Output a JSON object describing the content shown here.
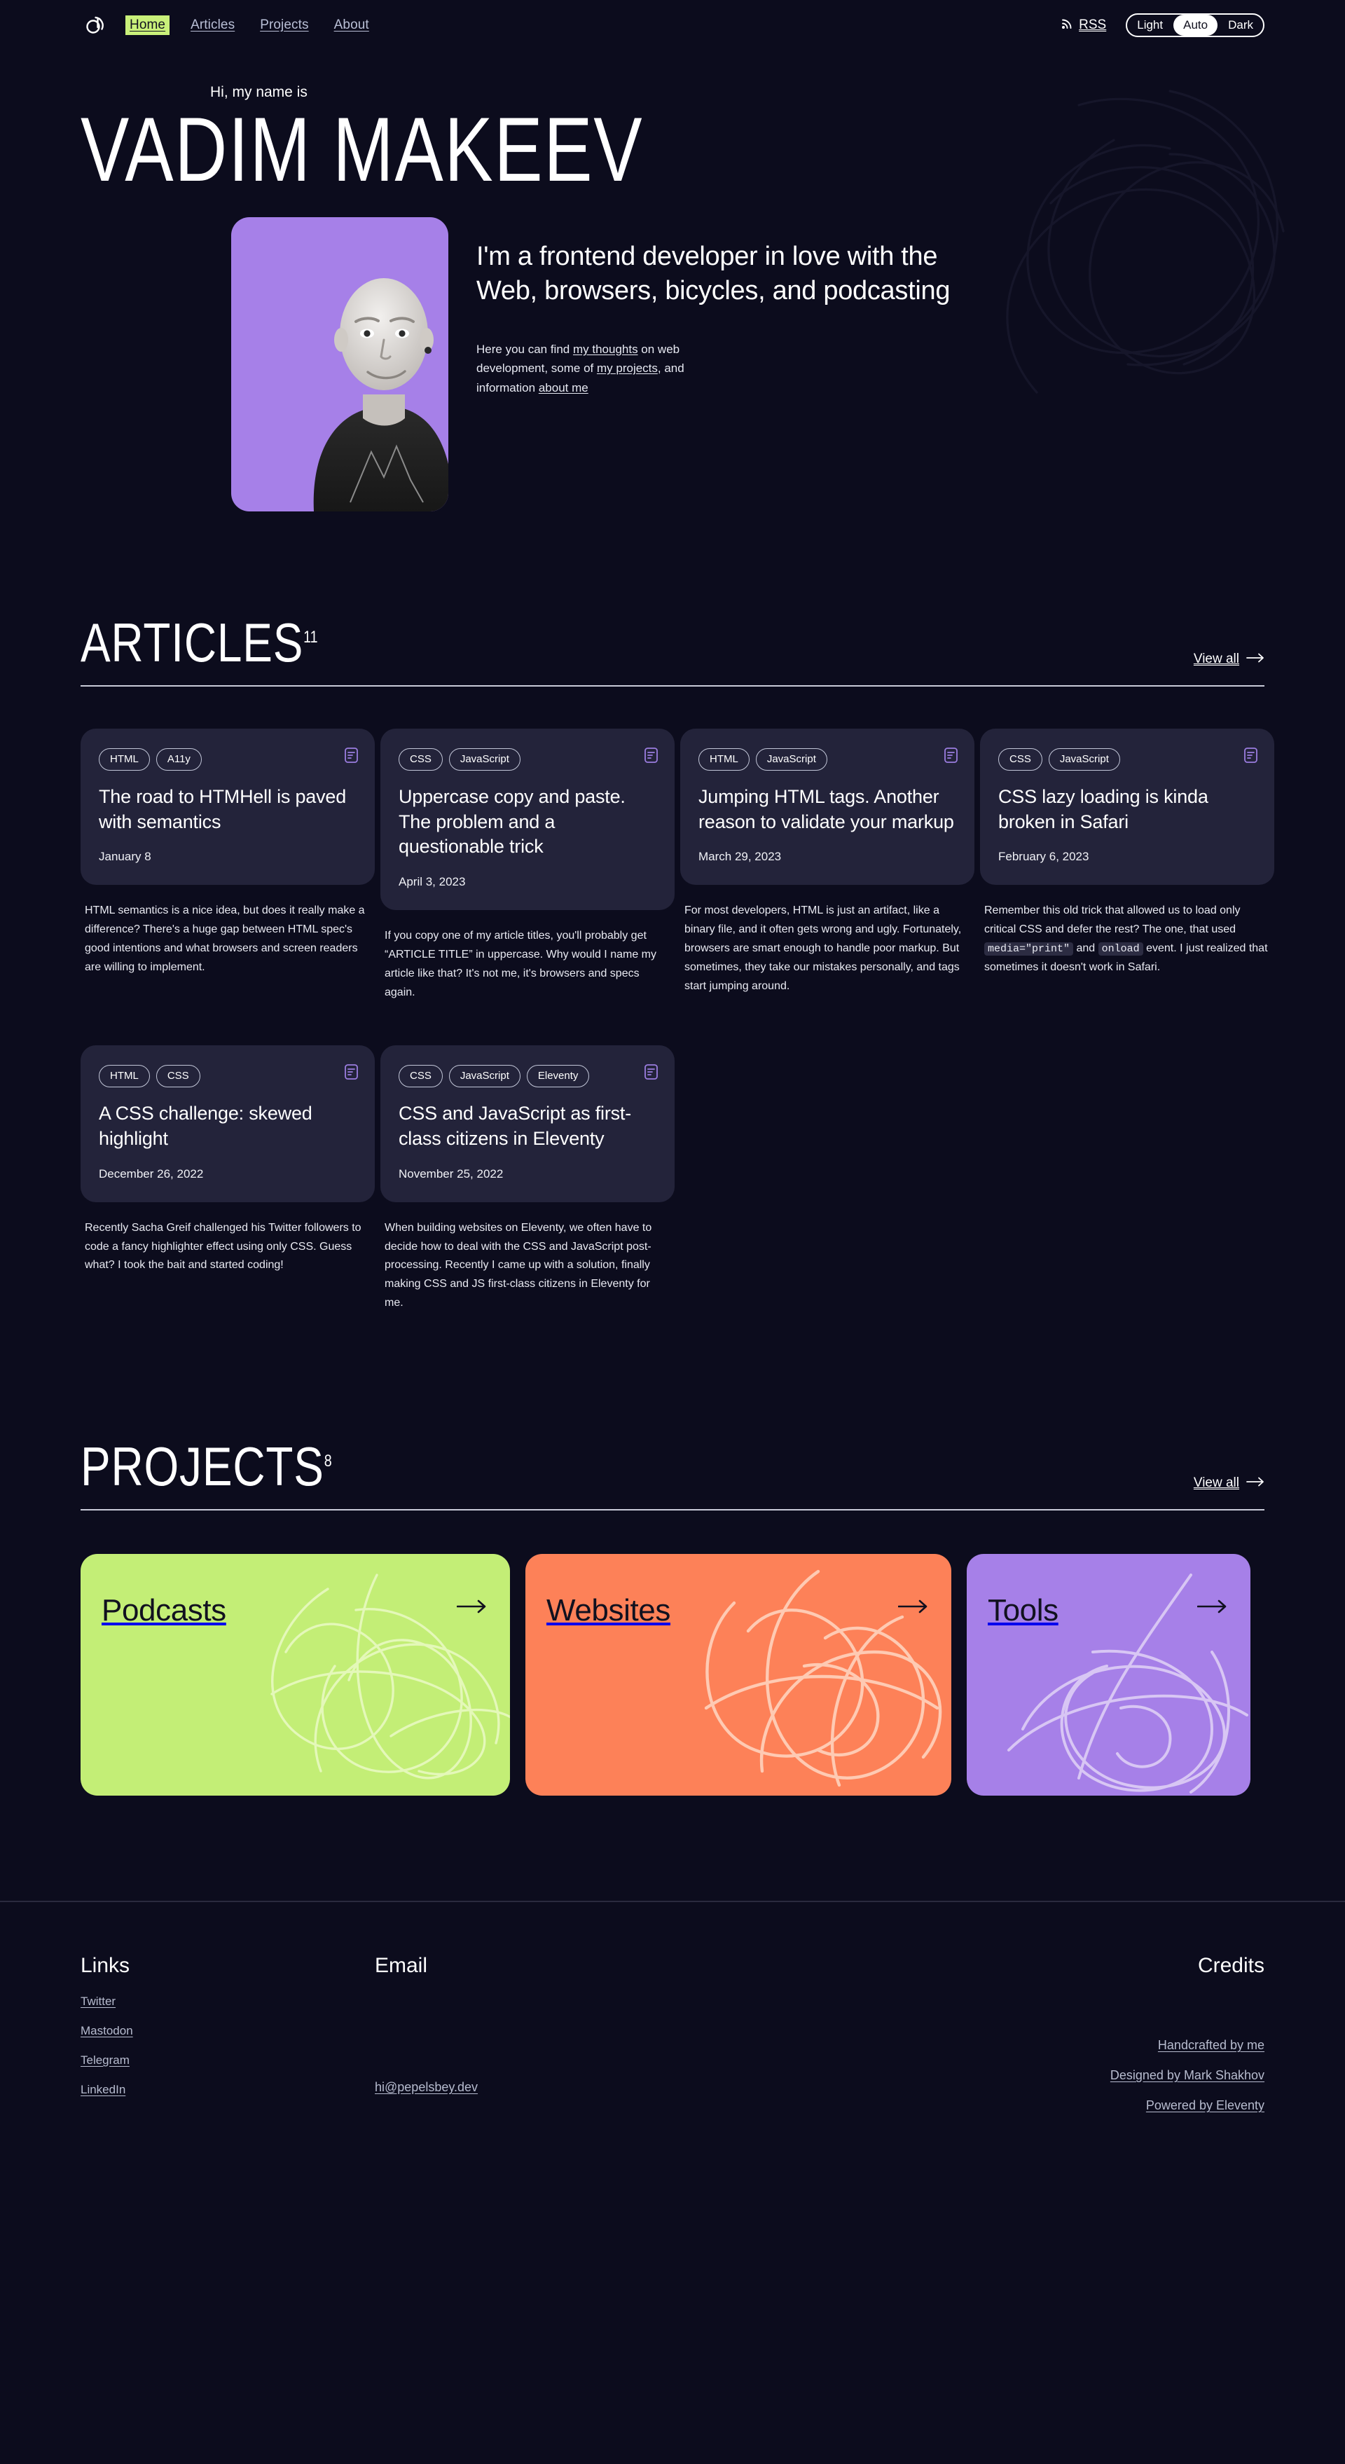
{
  "header": {
    "logo_icon": "at-logo-icon",
    "nav": [
      {
        "label": "Home",
        "active": true
      },
      {
        "label": "Articles",
        "active": false
      },
      {
        "label": "Projects",
        "active": false
      },
      {
        "label": "About",
        "active": false
      }
    ],
    "rss": {
      "label": "RSS",
      "icon": "rss-icon"
    },
    "theme": {
      "options": [
        "Light",
        "Auto",
        "Dark"
      ],
      "selected": "Auto"
    },
    "accent_green": "#c9f07a"
  },
  "hero": {
    "greeting": "Hi, my name is",
    "name": "VADIM MAKEEV",
    "tagline": "I'm a frontend developer in love with the Web, browsers, bicycles, and podcasting",
    "lede": {
      "part1": "Here you can find ",
      "link1": "my thoughts",
      "part2": " on web development, some of ",
      "link2": "my projects",
      "part3": ", and information ",
      "link3": "about me"
    },
    "photo_alt": "portrait-photo",
    "card_color": "#a680e8"
  },
  "articles": {
    "title": "ARTICLES",
    "count": "11",
    "view_all": "View all",
    "items": [
      {
        "tags": [
          "HTML",
          "A11y"
        ],
        "title": "The road to HTMHell is paved with semantics",
        "date": "January 8",
        "excerpt": "HTML semantics is a nice idea, but does it really make a difference? There's a huge gap between HTML spec's good intentions and what browsers and screen readers are willing to implement."
      },
      {
        "tags": [
          "CSS",
          "JavaScript"
        ],
        "title": "Uppercase copy and paste. The problem and a questionable trick",
        "date": "April 3, 2023",
        "excerpt": "If you copy one of my article titles, you'll probably get “ARTICLE TITLE” in uppercase. Why would I name my article like that? It's not me, it's browsers and specs again."
      },
      {
        "tags": [
          "HTML",
          "JavaScript"
        ],
        "title": "Jumping HTML tags. Another reason to validate your markup",
        "date": "March 29, 2023",
        "excerpt": "For most developers, HTML is just an artifact, like a binary file, and it often gets wrong and ugly. Fortunately, browsers are smart enough to handle poor markup. But sometimes, they take our mistakes personally, and tags start jumping around."
      },
      {
        "tags": [
          "CSS",
          "JavaScript"
        ],
        "title": "CSS lazy loading is kinda broken in Safari",
        "date": "February 6, 2023",
        "excerpt_pre": "Remember this old trick that allowed us to load only critical CSS and defer the rest? The one, that used ",
        "excerpt_code1": "media=\"print\"",
        "excerpt_mid": " and ",
        "excerpt_code2": "onload",
        "excerpt_post": " event. I just realized that sometimes it doesn't work in Safari."
      },
      {
        "tags": [
          "HTML",
          "CSS"
        ],
        "title": "A CSS challenge: skewed highlight",
        "date": "December 26, 2022",
        "excerpt": "Recently Sacha Greif challenged his Twitter followers to code a fancy highlighter effect using only CSS. Guess what? I took the bait and started coding!"
      },
      {
        "tags": [
          "CSS",
          "JavaScript",
          "Eleventy"
        ],
        "title": "CSS and JavaScript as first-class citizens in Eleventy",
        "date": "November 25, 2022",
        "excerpt": "When building websites on Eleventy, we often have to decide how to deal with the CSS and JavaScript post-processing. Recently I came up with a solution, finally making CSS and JS first-class citizens in Eleventy for me."
      }
    ]
  },
  "projects": {
    "title": "PROJECTS",
    "count": "8",
    "view_all": "View all",
    "items": [
      {
        "label": "Podcasts",
        "color": "#c3ee76",
        "scribble": "#e4f8b9"
      },
      {
        "label": "Websites",
        "color": "#fd8158",
        "scribble": "#fecab3"
      },
      {
        "label": "Tools",
        "color": "#a680e8",
        "scribble": "#d8c6f4"
      }
    ]
  },
  "footer": {
    "links": {
      "heading": "Links",
      "items": [
        "Twitter",
        "Mastodon",
        "Telegram",
        "LinkedIn"
      ]
    },
    "email": {
      "heading": "Email",
      "address": "hi@pepelsbey.dev"
    },
    "credits": {
      "heading": "Credits",
      "items": [
        "Handcrafted by me",
        "Designed by Mark Shakhov",
        "Powered by Eleventy"
      ]
    }
  }
}
